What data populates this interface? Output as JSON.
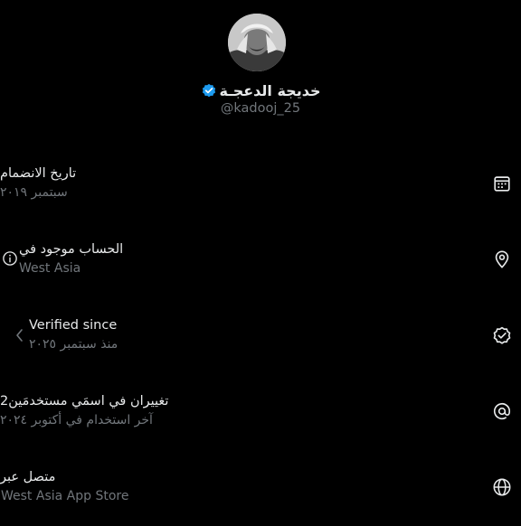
{
  "profile": {
    "display_name": "خديجة الدعجـة",
    "handle": "@kadooj_25",
    "verified_badge_color": "#1d9bf0"
  },
  "rows": [
    {
      "icon": "calendar-icon",
      "title": "تاريخ الانضمام",
      "subtitle": "سبتمبر ٢٠١٩"
    },
    {
      "icon": "location-pin-icon",
      "title": "الحساب موجود في",
      "subtitle": "West Asia",
      "info_icon": "info-icon"
    },
    {
      "icon": "verified-check-icon",
      "title": "Verified since",
      "subtitle": "منذ سبتمبر ٢٠٢٥",
      "chevron": "chevron-left-icon"
    },
    {
      "icon": "at-sign-icon",
      "title": "تغييران في اسمَي مستخدمَين2",
      "subtitle": "آخر استخدام في أكتوبر ٢٠٢٤"
    },
    {
      "icon": "globe-icon",
      "title": "متصل عبر",
      "subtitle": "West Asia App Store"
    }
  ],
  "colors": {
    "background": "#000000",
    "primary_text": "#e7e9ea",
    "secondary_text": "#71767b"
  }
}
